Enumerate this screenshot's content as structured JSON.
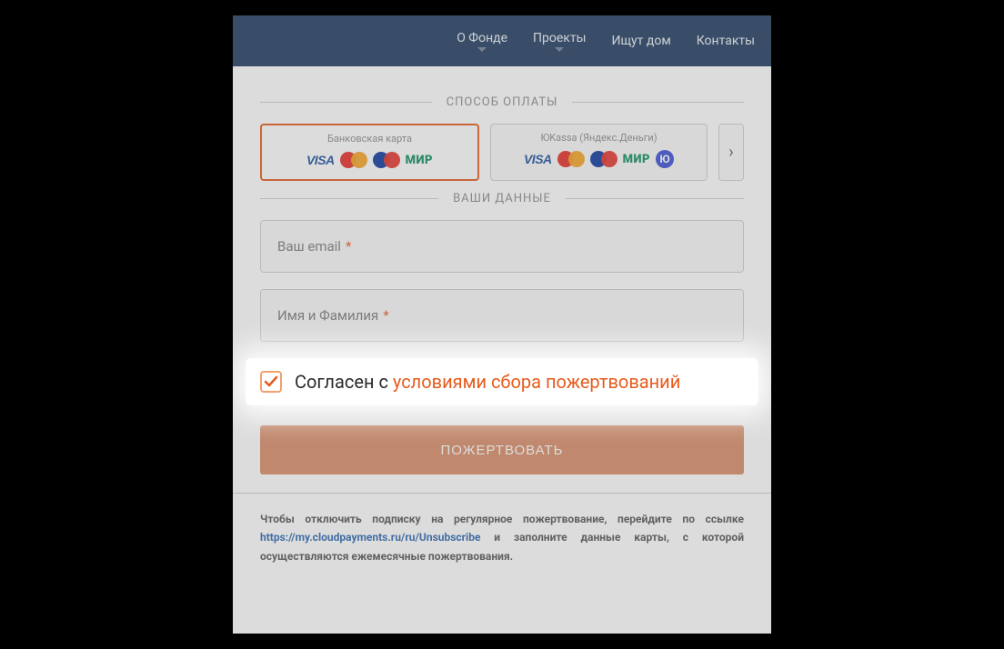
{
  "nav": {
    "about": "О Фонде",
    "projects": "Проекты",
    "looking_home": "Ищут дом",
    "contacts": "Контакты"
  },
  "sections": {
    "payment_method": "СПОСОБ ОПЛАТЫ",
    "your_data": "ВАШИ ДАННЫЕ"
  },
  "payment": {
    "card": {
      "title": "Банковская карта",
      "selected": true
    },
    "yookassa": {
      "title": "ЮKassa (Яндекс.Деньги)",
      "selected": false
    },
    "visa": "VISA",
    "mir": "МИР",
    "yoo": "Ю"
  },
  "form": {
    "email_label": "Ваш email",
    "name_label": "Имя и Фамилия",
    "required": "*"
  },
  "consent": {
    "checked": true,
    "text_prefix": "Согласен с ",
    "link_text": "условиями сбора пожертвований"
  },
  "donate_button": "ПОЖЕРТВОВАТЬ",
  "unsubscribe": {
    "part1": "Чтобы отключить подписку на регулярное пожертвование, перейдите по ссылке ",
    "link": "https://my.cloudpayments.ru/ru/Unsubscribe",
    "part2": " и заполните данные карты, с которой осуществляются ежемесячные пожертвования."
  }
}
